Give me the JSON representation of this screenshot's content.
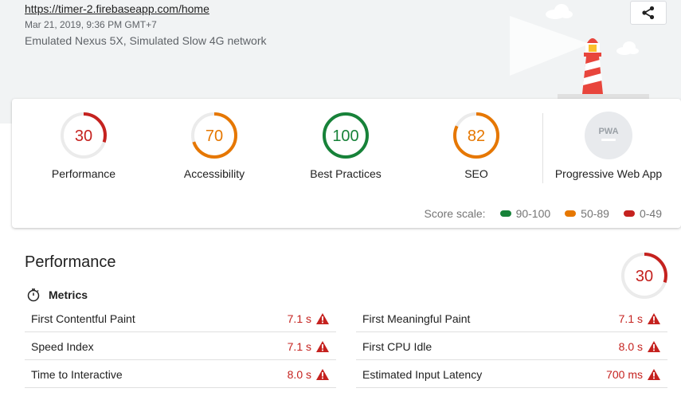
{
  "header": {
    "url": "https://timer-2.firebaseapp.com/home",
    "timestamp": "Mar 21, 2019, 9:36 PM GMT+7",
    "environment": "Emulated Nexus 5X, Simulated Slow 4G network",
    "share_icon": "share-icon"
  },
  "colors": {
    "fail": "#c5221f",
    "average": "#e67700",
    "pass": "#178239",
    "muted": "#dadce0"
  },
  "summary": {
    "categories": [
      {
        "label": "Performance",
        "score": "30",
        "value": 30,
        "status": "fail"
      },
      {
        "label": "Accessibility",
        "score": "70",
        "value": 70,
        "status": "average"
      },
      {
        "label": "Best Practices",
        "score": "100",
        "value": 100,
        "status": "pass"
      },
      {
        "label": "SEO",
        "score": "82",
        "value": 82,
        "status": "average"
      }
    ],
    "pwa": {
      "label": "Progressive Web App",
      "badge": "PWA",
      "icon": "pwa-badge-icon"
    },
    "scale": {
      "label": "Score scale:",
      "ranges": [
        {
          "text": "90-100",
          "color": "#178239"
        },
        {
          "text": "50-89",
          "color": "#e67700"
        },
        {
          "text": "0-49",
          "color": "#c5221f"
        }
      ]
    }
  },
  "performance": {
    "title": "Performance",
    "score": "30",
    "value": 30,
    "metrics_label": "Metrics",
    "metrics_icon": "stopwatch-icon",
    "metrics": [
      {
        "name": "First Contentful Paint",
        "value": "7.1 s"
      },
      {
        "name": "First Meaningful Paint",
        "value": "7.1 s"
      },
      {
        "name": "Speed Index",
        "value": "7.1 s"
      },
      {
        "name": "First CPU Idle",
        "value": "8.0 s"
      },
      {
        "name": "Time to Interactive",
        "value": "8.0 s"
      },
      {
        "name": "Estimated Input Latency",
        "value": "700 ms"
      }
    ]
  }
}
